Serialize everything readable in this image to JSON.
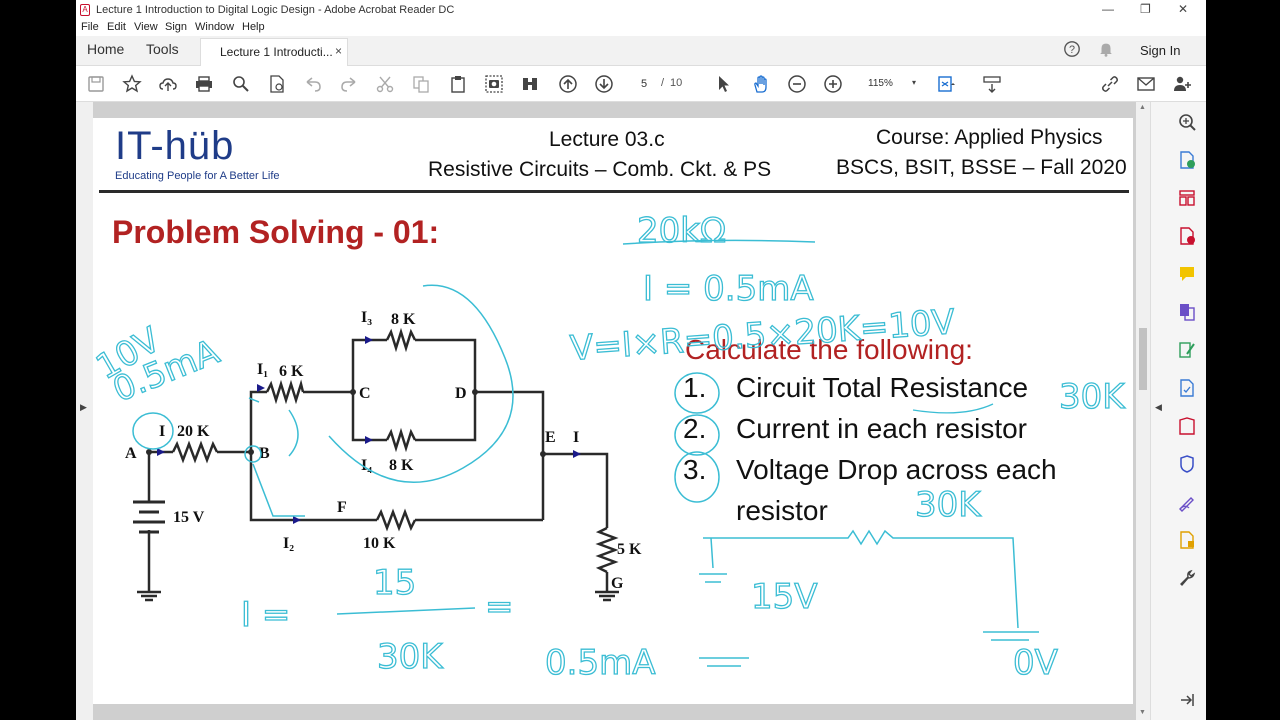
{
  "window": {
    "title": "Lecture 1 Introduction to Digital Logic Design - Adobe Acrobat Reader DC",
    "controls": {
      "minimize": "—",
      "restore": "❐",
      "close": "✕"
    }
  },
  "menu": [
    "File",
    "Edit",
    "View",
    "Sign",
    "Window",
    "Help"
  ],
  "tabs": {
    "home": "Home",
    "tools": "Tools",
    "document": "Lecture 1 Introducti...",
    "close": "×"
  },
  "account": {
    "sign_in": "Sign In"
  },
  "toolbar": {
    "page_current": "5",
    "page_separator": "/",
    "page_total": "10",
    "zoom": "115%",
    "zoom_caret": "▾"
  },
  "icons": {
    "toolbar": [
      "save-icon",
      "bookmark-star-icon",
      "upload-icon",
      "print-icon",
      "find-icon",
      "scan-icon",
      "undo-icon",
      "redo-icon",
      "cut-icon",
      "copy-icon",
      "paste-icon",
      "snapshot-icon",
      "compare-icon",
      "page-up-icon",
      "page-down-icon",
      "select-icon",
      "hand-icon",
      "zoom-out-icon",
      "zoom-in-icon",
      "fit-page-icon",
      "scroll-icon",
      "share-link-icon",
      "email-icon",
      "add-user-icon"
    ],
    "right_panel": [
      "search-zoom-icon",
      "export-pdf-icon",
      "organize-pages-icon",
      "create-pdf-icon",
      "comment-icon",
      "combine-icon",
      "edit-pdf-icon",
      "fill-sign-icon",
      "protect-icon",
      "sign-icon",
      "scan-ocr-icon",
      "more-tools-icon",
      "expand-icon"
    ]
  },
  "slide": {
    "logo": {
      "text": "IT-hüb",
      "tagline": "Educating People for A Better Life"
    },
    "lecture": {
      "line1": "Lecture 03.c",
      "line2": "Resistive Circuits – Comb. Ckt. & PS"
    },
    "course": {
      "line1": "Course: Applied Physics",
      "line2": "BSCS, BSIT, BSSE – Fall 2020"
    },
    "problem_title": "Problem Solving - 01:",
    "calc_title": "Calculate the following:",
    "tasks": [
      {
        "num": "1.",
        "text": "Circuit Total Resistance"
      },
      {
        "num": "2.",
        "text": "Current in each resistor"
      },
      {
        "num": "3.",
        "text": "Voltage Drop across each"
      },
      {
        "num": "",
        "text": "resistor"
      }
    ],
    "circuit_labels": {
      "i3": "I₃",
      "r8a": "8 K",
      "i1": "I₁",
      "r6": "6 K",
      "c": "C",
      "d": "D",
      "i": "I",
      "r20": "20 K",
      "a": "A",
      "b": "B",
      "e": "E",
      "ie": "I",
      "i4": "I₄",
      "r8b": "8 K",
      "v15": "15 V",
      "f": "F",
      "r10": "10 K",
      "i2": "I₂",
      "r5": "5 K",
      "g": "G"
    },
    "handwriting": {
      "r20kohm": "20kΩ",
      "i_eq": "I = 0.5mA",
      "v_eq": "V=I×R=0.5×20K=10V",
      "v10": "10V",
      "i05": "0.5mA",
      "r30k": "30K",
      "r30k_b": "30K",
      "v15": "15V",
      "i_frac_lhs": "I =",
      "i_frac_num": "15",
      "i_frac_den": "30K",
      "i_frac_eq": "=",
      "i_frac_res": "0.5mA",
      "v0": "0V"
    }
  },
  "colors": {
    "accent_red": "#b22222",
    "logo_blue": "#1f3c88",
    "annotation_cyan": "#3bbdd4",
    "brand_red": "#c8102e"
  }
}
